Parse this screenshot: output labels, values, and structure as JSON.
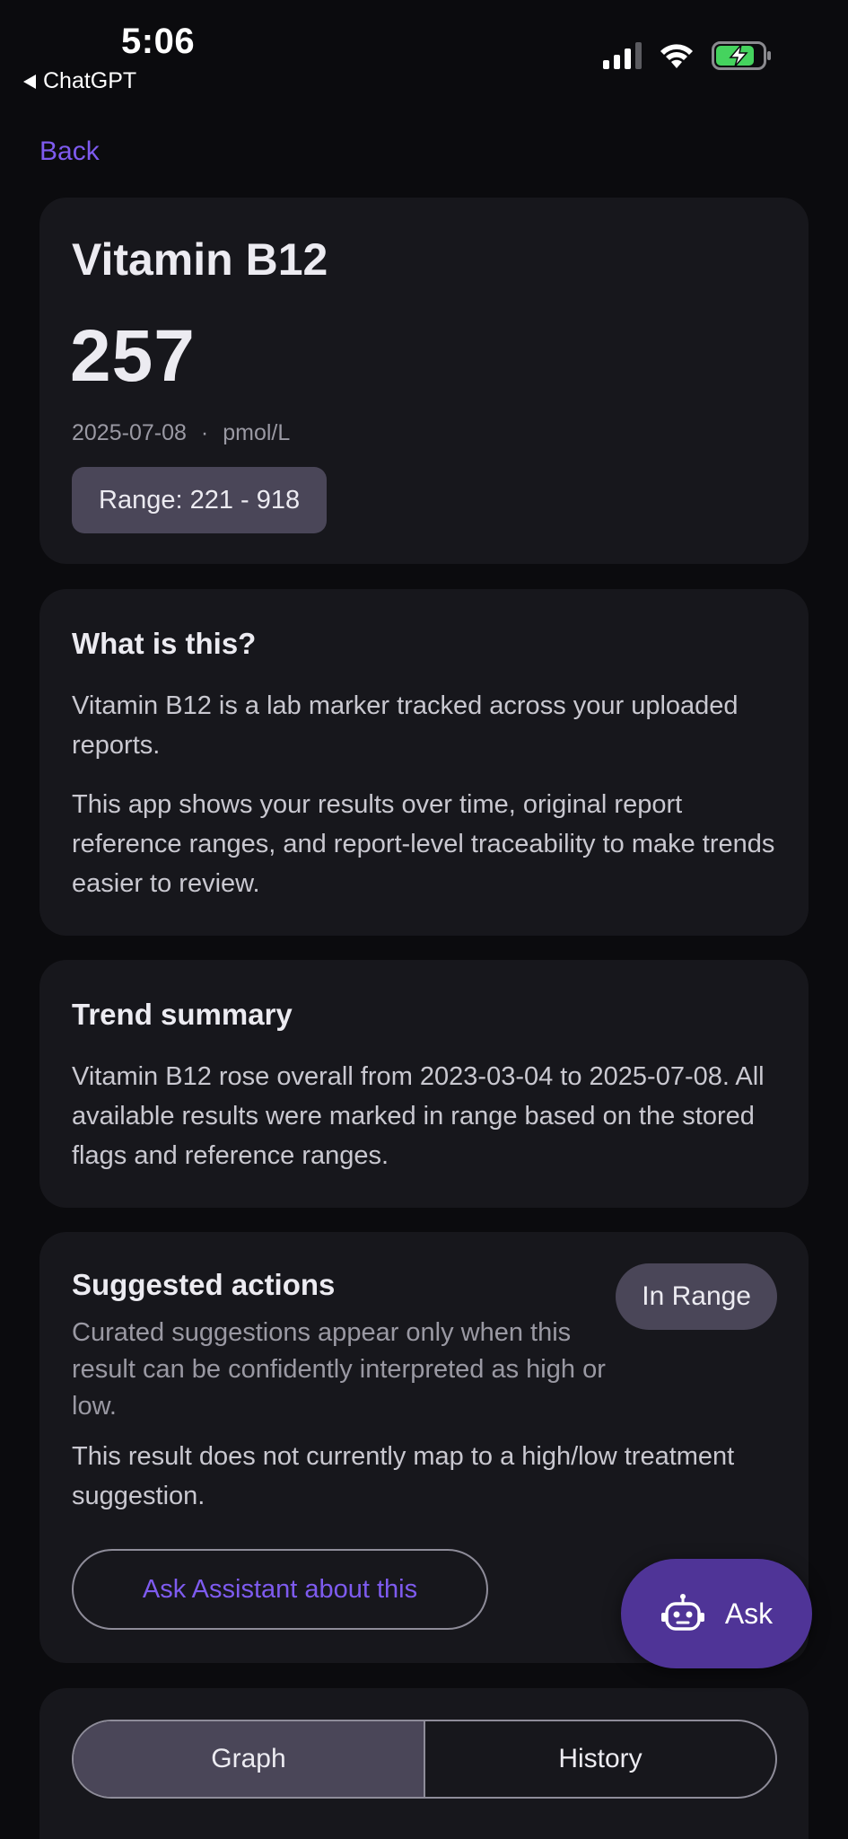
{
  "status_bar": {
    "time": "5:06",
    "back_app": "ChatGPT",
    "icons": [
      "cellular-signal",
      "wifi",
      "battery-charging"
    ]
  },
  "nav": {
    "back_label": "Back"
  },
  "marker": {
    "name": "Vitamin B12",
    "value": "257",
    "date": "2025-07-08",
    "separator": "·",
    "unit": "pmol/L",
    "range_label": "Range: 221 - 918"
  },
  "about": {
    "title": "What is this?",
    "paragraph1": "Vitamin B12 is a lab marker tracked across your uploaded reports.",
    "paragraph2": "This app shows your results over time, original report reference ranges, and report-level traceability to make trends easier to review."
  },
  "trend": {
    "title": "Trend summary",
    "text": "Vitamin B12 rose overall from 2023-03-04 to 2025-07-08. All available results were marked in range based on the stored flags and reference ranges."
  },
  "actions": {
    "title": "Suggested actions",
    "subtitle": "Curated suggestions appear only when this result can be confidently interpreted as high or low.",
    "status_badge": "In Range",
    "text": "This result does not currently map to a high/low treatment suggestion.",
    "ask_button": "Ask Assistant about this"
  },
  "fab": {
    "label": "Ask",
    "icon": "robot-icon"
  },
  "view_toggle": {
    "options": [
      "Graph",
      "History"
    ],
    "selected": "Graph"
  },
  "colors": {
    "background": "#0b0b0e",
    "card": "#17171c",
    "accent": "#7e5bef",
    "fab": "#4f3497",
    "pill": "#4a4658"
  }
}
